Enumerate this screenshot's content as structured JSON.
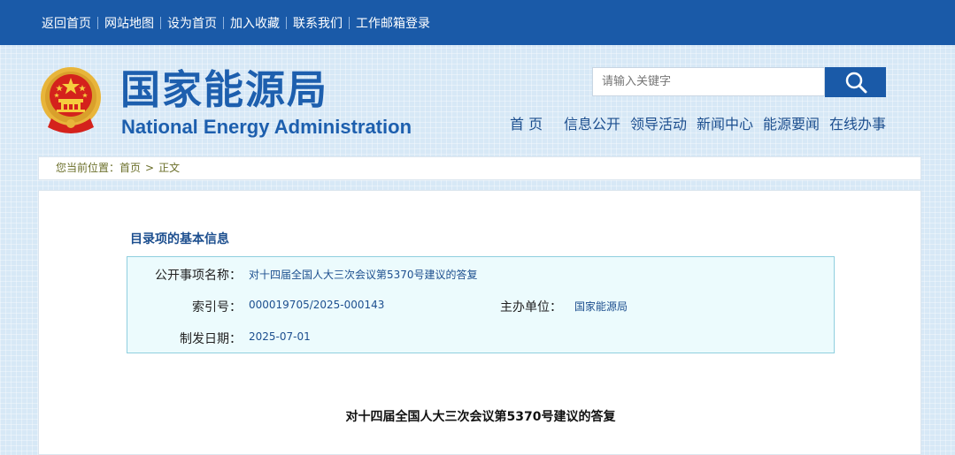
{
  "topbar": {
    "links": [
      "返回首页",
      "网站地图",
      "设为首页",
      "加入收藏",
      "联系我们",
      "工作邮箱登录"
    ]
  },
  "header": {
    "site_name_cn": "国家能源局",
    "site_name_en": "National Energy Administration",
    "emblem_icon": "national-emblem-icon"
  },
  "search": {
    "placeholder": "请输入关键字",
    "button_icon": "search-icon"
  },
  "nav": {
    "items": [
      "首 页",
      "信息公开",
      "领导活动",
      "新闻中心",
      "能源要闻",
      "在线办事"
    ]
  },
  "breadcrumb": {
    "prefix": "您当前位置：",
    "home": "首页",
    "separator": ">",
    "current": "正文"
  },
  "info": {
    "section_title": "目录项的基本信息",
    "name_label": "公开事项名称：",
    "name_value": "对十四届全国人大三次会议第5370号建议的答复",
    "index_label": "索引号：",
    "index_value": "000019705/2025-000143",
    "org_label": "主办单位：",
    "org_value": "国家能源局",
    "date_label": "制发日期：",
    "date_value": "2025-07-01"
  },
  "article": {
    "title": "对十四届全国人大三次会议第5370号建议的答复"
  },
  "colors": {
    "topbar": "#1a5aa8",
    "brand_blue": "#1d5fae",
    "info_box_bg": "#ecfbfd",
    "info_box_border": "#8fcfdf"
  }
}
